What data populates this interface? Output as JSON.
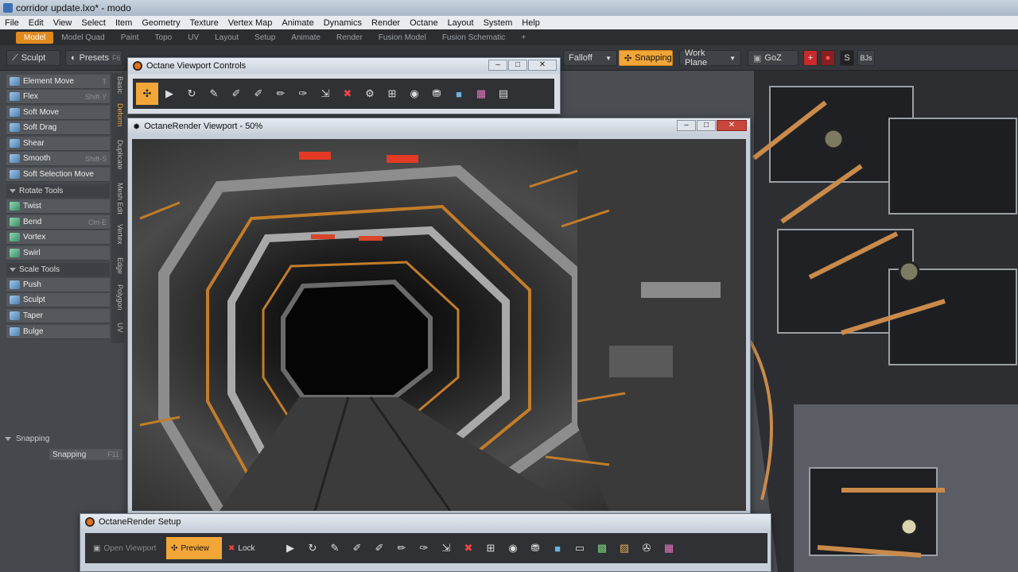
{
  "window": {
    "title": "corridor update.lxo* - modo"
  },
  "menu": [
    "File",
    "Edit",
    "View",
    "Select",
    "Item",
    "Geometry",
    "Texture",
    "Vertex Map",
    "Animate",
    "Dynamics",
    "Render",
    "Octane",
    "Layout",
    "System",
    "Help"
  ],
  "layout_tabs": [
    "Model",
    "Model Quad",
    "Paint",
    "Topo",
    "UV",
    "Layout",
    "Setup",
    "Animate",
    "Render",
    "Fusion Model",
    "Fusion Schematic",
    "+"
  ],
  "toolbar": {
    "sculpt": "Sculpt",
    "presets": "Presets",
    "presets_key": "F6",
    "falloff": "Falloff",
    "snapping": "Snapping",
    "work_plane": "Work Plane",
    "goz": "GoZ",
    "bjs": "BJs"
  },
  "tools": {
    "element_move": {
      "label": "Element Move",
      "key": "T"
    },
    "flex": {
      "label": "Flex",
      "key": "Shift-Y"
    },
    "soft_move": {
      "label": "Soft Move"
    },
    "soft_drag": {
      "label": "Soft Drag"
    },
    "shear": {
      "label": "Shear"
    },
    "smooth": {
      "label": "Smooth",
      "key": "Shift-S"
    },
    "soft_selection_move": {
      "label": "Soft Selection Move"
    },
    "rotate_group": "Rotate Tools",
    "twist": {
      "label": "Twist"
    },
    "bend": {
      "label": "Bend",
      "key": "Ctrl-E"
    },
    "vortex": {
      "label": "Vortex"
    },
    "swirl": {
      "label": "Swirl"
    },
    "scale_group": "Scale Tools",
    "push": {
      "label": "Push"
    },
    "sculpt": {
      "label": "Sculpt"
    },
    "taper": {
      "label": "Taper"
    },
    "bulge": {
      "label": "Bulge"
    }
  },
  "vtabs": [
    "Basic",
    "Deform",
    "Duplicate",
    "Mesh Edit",
    "Vertex",
    "Edge",
    "Polygon",
    "UV"
  ],
  "snapping_panel": {
    "header": "Snapping",
    "item": "Snapping",
    "key": "F11"
  },
  "octane_controls": {
    "title": "Octane Viewport Controls"
  },
  "render_viewport": {
    "title": "OctaneRender Viewport - 50%"
  },
  "render_setup": {
    "title": "OctaneRender Setup",
    "open_viewport": "Open Viewport",
    "preview": "Preview",
    "lock": "Lock"
  }
}
